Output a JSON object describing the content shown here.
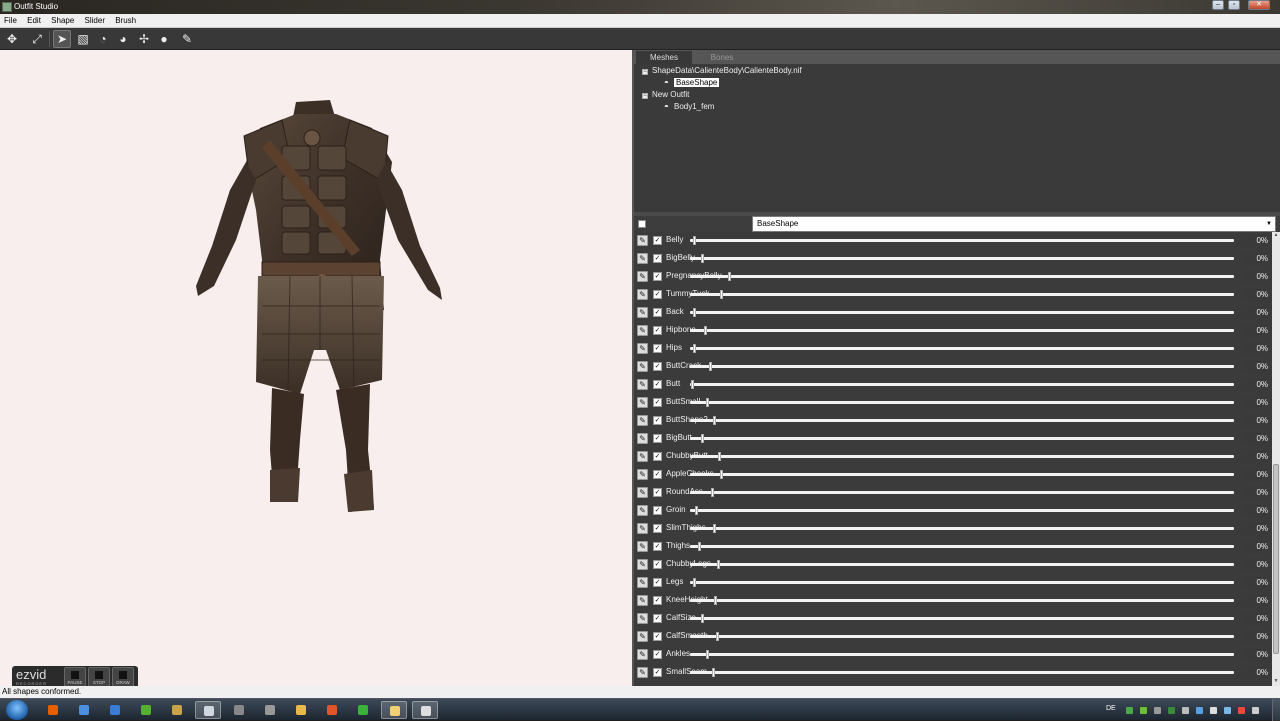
{
  "window": {
    "title": "Outfit Studio",
    "controls": [
      "minimize",
      "maximize",
      "close"
    ]
  },
  "menu": [
    "File",
    "Edit",
    "Shape",
    "Slider",
    "Brush"
  ],
  "toolbar": {
    "tools": [
      {
        "name": "select-tool-icon",
        "glyph": "✥"
      },
      {
        "name": "transform-tool-icon",
        "glyph": "⤢"
      },
      {
        "name": "brush-tool-icon",
        "glyph": "➤"
      },
      {
        "name": "mask-brush-icon",
        "glyph": "▧"
      },
      {
        "name": "inflate-brush-icon",
        "glyph": "◔"
      },
      {
        "name": "deflate-brush-icon",
        "glyph": "◕"
      },
      {
        "name": "move-brush-icon",
        "glyph": "✢"
      },
      {
        "name": "smooth-brush-icon",
        "glyph": "●"
      },
      {
        "name": "paint-brush-icon",
        "glyph": "✎"
      }
    ]
  },
  "panel": {
    "tabs": [
      {
        "label": "Meshes",
        "active": true
      },
      {
        "label": "Bones",
        "active": false
      }
    ],
    "tree": [
      {
        "label": "ShapeData\\CalienteBody\\CalienteBody.nif",
        "expander": "−",
        "selected": false,
        "eye": false
      },
      {
        "label": "BaseShape",
        "expander": "",
        "selected": true,
        "eye": true
      },
      {
        "label": "New Outfit",
        "expander": "−",
        "selected": false,
        "eye": false
      },
      {
        "label": "Body1_fem",
        "expander": "",
        "selected": false,
        "eye": true
      }
    ],
    "reference_shape": "BaseShape"
  },
  "sliders": [
    {
      "name": "Belly",
      "pos": 0.005,
      "value": "0%"
    },
    {
      "name": "BigBelly",
      "pos": 0.02,
      "value": "0%"
    },
    {
      "name": "PregnancyBelly",
      "pos": 0.07,
      "value": "0%"
    },
    {
      "name": "TummyTuck",
      "pos": 0.055,
      "value": "0%"
    },
    {
      "name": "Back",
      "pos": 0.005,
      "value": "0%"
    },
    {
      "name": "Hipbone",
      "pos": 0.025,
      "value": "0%"
    },
    {
      "name": "Hips",
      "pos": 0.005,
      "value": "0%"
    },
    {
      "name": "ButtCrack",
      "pos": 0.035,
      "value": "0%"
    },
    {
      "name": "Butt",
      "pos": 0.002,
      "value": "0%"
    },
    {
      "name": "ButtSmall",
      "pos": 0.03,
      "value": "0%"
    },
    {
      "name": "ButtShape2",
      "pos": 0.042,
      "value": "0%"
    },
    {
      "name": "BigButt",
      "pos": 0.02,
      "value": "0%"
    },
    {
      "name": "ChubbyButt",
      "pos": 0.052,
      "value": "0%"
    },
    {
      "name": "AppleCheeks",
      "pos": 0.055,
      "value": "0%"
    },
    {
      "name": "RoundAss",
      "pos": 0.038,
      "value": "0%"
    },
    {
      "name": "Groin",
      "pos": 0.01,
      "value": "0%"
    },
    {
      "name": "SlimThighs",
      "pos": 0.042,
      "value": "0%"
    },
    {
      "name": "Thighs",
      "pos": 0.015,
      "value": "0%"
    },
    {
      "name": "ChubbyLegs",
      "pos": 0.05,
      "value": "0%"
    },
    {
      "name": "Legs",
      "pos": 0.005,
      "value": "0%"
    },
    {
      "name": "KneeHeight",
      "pos": 0.045,
      "value": "0%"
    },
    {
      "name": "CalfSize",
      "pos": 0.02,
      "value": "0%"
    },
    {
      "name": "CalfSmooth",
      "pos": 0.048,
      "value": "0%"
    },
    {
      "name": "Ankles",
      "pos": 0.03,
      "value": "0%"
    },
    {
      "name": "SmallSeam",
      "pos": 0.04,
      "value": "0%"
    }
  ],
  "status": "All shapes conformed.",
  "overlay": {
    "logo": "ezvid",
    "sublogo": "RECORDER",
    "buttons": [
      "PAUSE",
      "STOP",
      "DRAW"
    ]
  },
  "taskbar": {
    "apps": [
      {
        "name": "firefox-icon",
        "color": "#e66000"
      },
      {
        "name": "chrome-icon",
        "color": "#4a8fe0"
      },
      {
        "name": "ie-icon",
        "color": "#3a7bd5"
      },
      {
        "name": "utorrent-icon",
        "color": "#55b030"
      },
      {
        "name": "game-icon",
        "color": "#c9a24a"
      },
      {
        "name": "steam-icon",
        "color": "#cfd8e0",
        "active": true
      },
      {
        "name": "notepad-icon",
        "color": "#888"
      },
      {
        "name": "controller-icon",
        "color": "#999"
      },
      {
        "name": "folder-icon",
        "color": "#e8b84a"
      },
      {
        "name": "office-icon",
        "color": "#e0552a"
      },
      {
        "name": "app-green-icon",
        "color": "#3bb33b"
      },
      {
        "name": "explorer-icon",
        "color": "#f0d070",
        "active": true
      },
      {
        "name": "outfit-studio-icon",
        "color": "#ddd",
        "active": true
      }
    ],
    "language": "DE"
  }
}
